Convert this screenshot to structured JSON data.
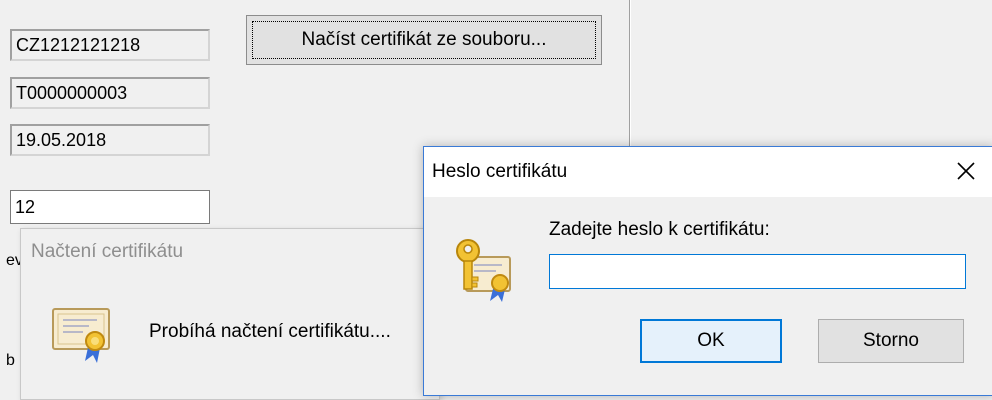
{
  "form": {
    "dic_value": "CZ1212121218",
    "cert_id_value": "T0000000003",
    "date_value": "19.05.2018",
    "edit_value": "12",
    "load_button_label": "Načíst certifikát ze souboru..."
  },
  "progress_dialog": {
    "title": "Načtení certifikátu",
    "message": "Probíhá načtení certifikátu...."
  },
  "password_dialog": {
    "title": "Heslo certifikátu",
    "prompt": "Zadejte heslo k certifikátu:",
    "password_value": "",
    "ok_label": "OK",
    "cancel_label": "Storno"
  },
  "icons": {
    "progress": "certificate-icon",
    "password": "key-certificate-icon",
    "close": "close-icon"
  },
  "colors": {
    "focus_blue": "#0078d7",
    "dialog_bg": "#f0f0f0"
  }
}
